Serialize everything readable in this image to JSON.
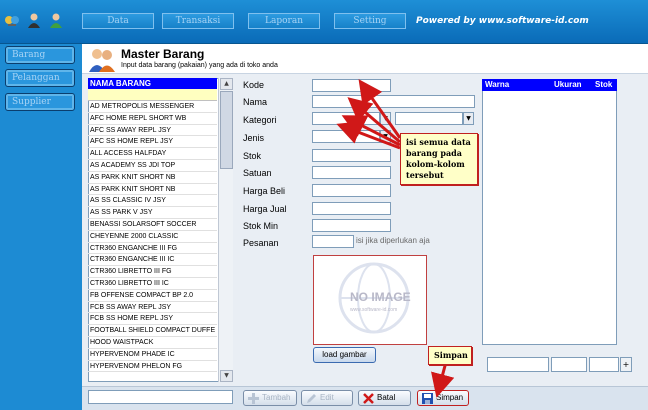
{
  "topbar": {
    "menu": [
      "Data",
      "Transaksi",
      "Laporan",
      "Setting"
    ],
    "powered": "Powered by www.software-id.com"
  },
  "sidebar": {
    "items": [
      {
        "label": "Barang"
      },
      {
        "label": "Pelanggan"
      },
      {
        "label": "Supplier"
      }
    ]
  },
  "header": {
    "title": "Master Barang",
    "subtitle": "Input data barang (pakaian) yang ada di toko anda"
  },
  "list": {
    "column": "NAMA BARANG",
    "rows": [
      "AD METROPOLIS MESSENGER",
      "AFC HOME  REPL SHORT WB",
      "AFC SS AWAY REPL JSY",
      "AFC SS HOME REPL JSY",
      "ALL ACCESS HALFDAY",
      "AS ACADEMY SS JDI TOP",
      "AS PARK KNIT SHORT NB",
      "AS PARK KNIT SHORT NB",
      "AS SS CLASSIC IV JSY",
      "AS SS PARK V JSY",
      "BENASSI SOLARSOFT SOCCER",
      "CHEYENNE 2000 CLASSIC",
      "CTR360 ENGANCHE III FG",
      "CTR360 ENGANCHE III IC",
      "CTR360 LIBRETTO III FG",
      "CTR360 LIBRETTO III IC",
      "FB OFFENSE COMPACT BP 2.0",
      "FCB SS AWAY REPL JSY",
      "FCB SS HOME REPL JSY",
      "FOOTBALL SHIELD COMPACT DUFFE",
      "HOOD WAISTPACK",
      "HYPERVENOM PHADE IC",
      "HYPERVENOM PHELON FG"
    ]
  },
  "form": {
    "labels": {
      "kode": "Kode",
      "nama": "Nama",
      "kategori": "Kategori",
      "jenis": "Jenis",
      "stok": "Stok",
      "satuan": "Satuan",
      "harga_beli": "Harga Beli",
      "harga_jual": "Harga Jual",
      "stok_min": "Stok Min",
      "pesanan": "Pesanan"
    },
    "pesanan_hint": "isi jika diperlukan aja",
    "no_image": "NO IMAGE",
    "no_image_sub": "www.software-id.com",
    "load_button": "load gambar"
  },
  "grid": {
    "columns": [
      "Warna",
      "Ukuran",
      "Stok"
    ]
  },
  "actions": {
    "tambah": "Tambah",
    "edit": "Edit",
    "batal": "Batal",
    "simpan": "Simpan"
  },
  "callouts": {
    "fill": "isi semua data barang pada kolom-kolom tersebut",
    "save": "Simpan"
  },
  "colors": {
    "top_blue": "#1e8fd6",
    "list_header": "#0000ff",
    "callout_bg": "#ffffc8",
    "arrow_red": "#d01818"
  }
}
